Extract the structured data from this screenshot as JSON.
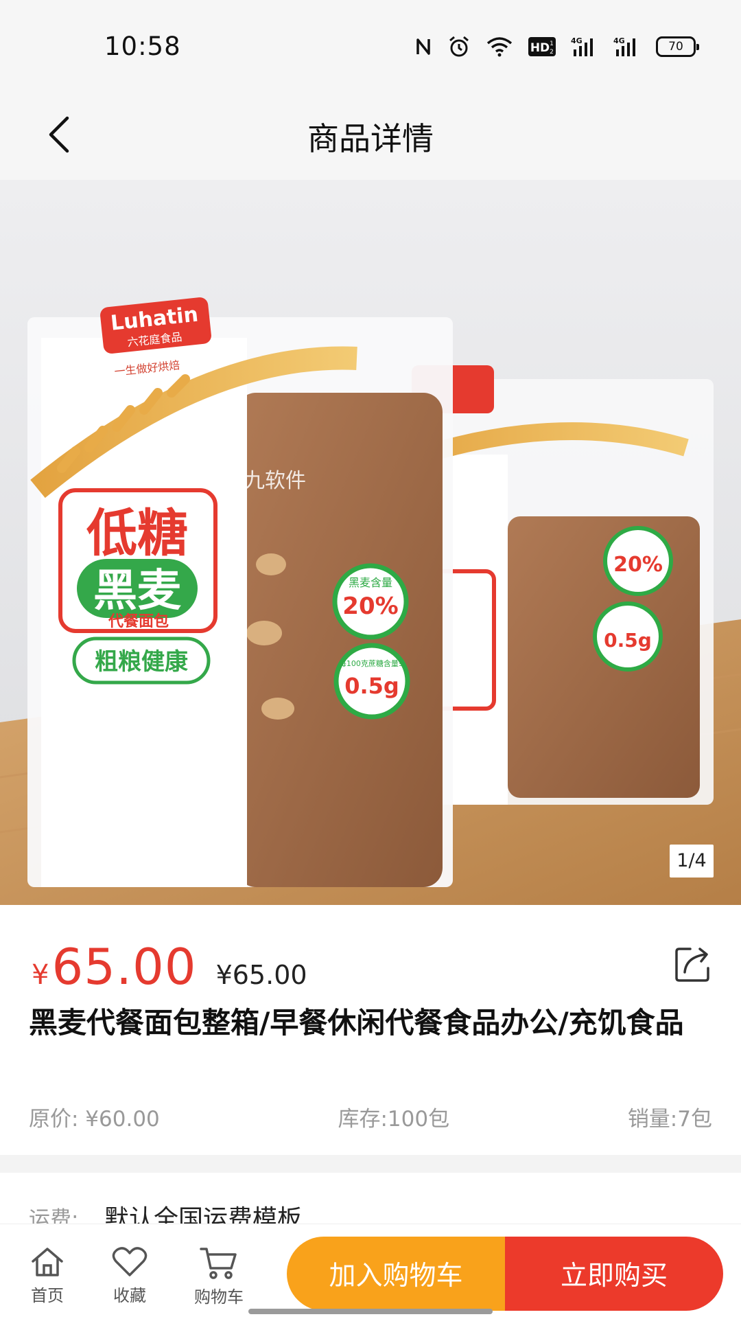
{
  "status_bar": {
    "time": "10:58",
    "icons": [
      "nfc-icon",
      "alarm-icon",
      "wifi-icon",
      "hd-icon",
      "signal-4g-icon",
      "signal-4g-icon",
      "battery-icon"
    ],
    "hd_label": "HD",
    "network_1": "4G",
    "network_2": "4G",
    "battery_level": "70"
  },
  "nav": {
    "title": "商品详情",
    "back_icon": "chevron-left-icon"
  },
  "gallery": {
    "page_indicator": "1/4",
    "current_page": 1,
    "total_pages": 4,
    "watermark": "五九软件",
    "package_brand": "Luhatin",
    "package_brand_cn": "六花庭食品",
    "package_slogan": "一生做好烘焙",
    "package_headline_1": "低糖",
    "package_headline_2": "黑麦",
    "package_subtitle": "代餐面包",
    "package_tagline": "粗粮健康",
    "sticker_1_label": "黑麦含量",
    "sticker_1_value": "20%",
    "sticker_2_label": "每100克蔗糖含量≤",
    "sticker_2_value": "0.5g"
  },
  "product": {
    "price_symbol": "¥",
    "price": "65.00",
    "secondary_price": "¥65.00",
    "title": "黑麦代餐面包整箱/早餐休闲代餐食品办公/充饥食品",
    "original_price": "原价: ¥60.00",
    "stock": "库存:100包",
    "sales": "销量:7包",
    "share_icon": "share-icon"
  },
  "shipping": {
    "label": "运费:",
    "value": "默认全国运费模板"
  },
  "bottom_bar": {
    "home_label": "首页",
    "favorite_label": "收藏",
    "cart_label": "购物车",
    "add_to_cart": "加入购物车",
    "buy_now": "立即购买"
  },
  "colors": {
    "accent_red": "#e53a2f",
    "cart_button": "#f9a21b",
    "buy_button": "#ec3a2b"
  }
}
